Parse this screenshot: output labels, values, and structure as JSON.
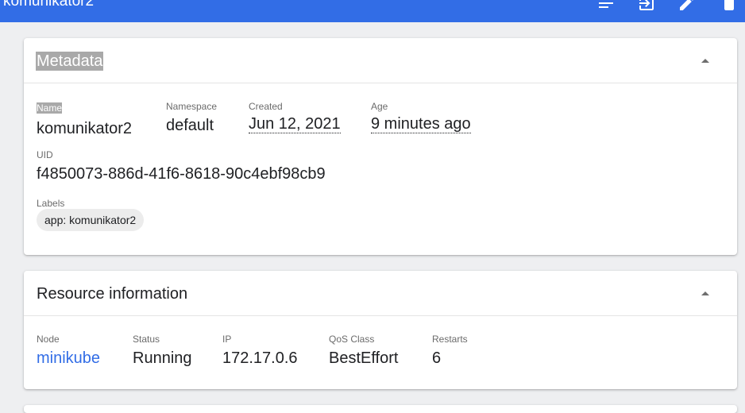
{
  "toolbar": {
    "title": "komunikator2",
    "actions": [
      {
        "name": "logs-icon"
      },
      {
        "name": "exec-icon"
      },
      {
        "name": "edit-icon"
      },
      {
        "name": "delete-icon"
      }
    ]
  },
  "metadata": {
    "title": "Metadata",
    "name_label": "Name",
    "name_value": "komunikator2",
    "namespace_label": "Namespace",
    "namespace_value": "default",
    "created_label": "Created",
    "created_value": "Jun 12, 2021",
    "age_label": "Age",
    "age_value": "9 minutes ago",
    "uid_label": "UID",
    "uid_value": "f4850073-886d-41f6-8618-90c4ebf98cb9",
    "labels_label": "Labels",
    "labels": [
      "app: komunikator2"
    ]
  },
  "resource": {
    "title": "Resource information",
    "node_label": "Node",
    "node_value": "minikube",
    "status_label": "Status",
    "status_value": "Running",
    "ip_label": "IP",
    "ip_value": "172.17.0.6",
    "qos_label": "QoS Class",
    "qos_value": "BestEffort",
    "restarts_label": "Restarts",
    "restarts_value": "6"
  },
  "colors": {
    "brand": "#326de6",
    "background": "#eeeff1",
    "selection": "#a9a9a9"
  }
}
